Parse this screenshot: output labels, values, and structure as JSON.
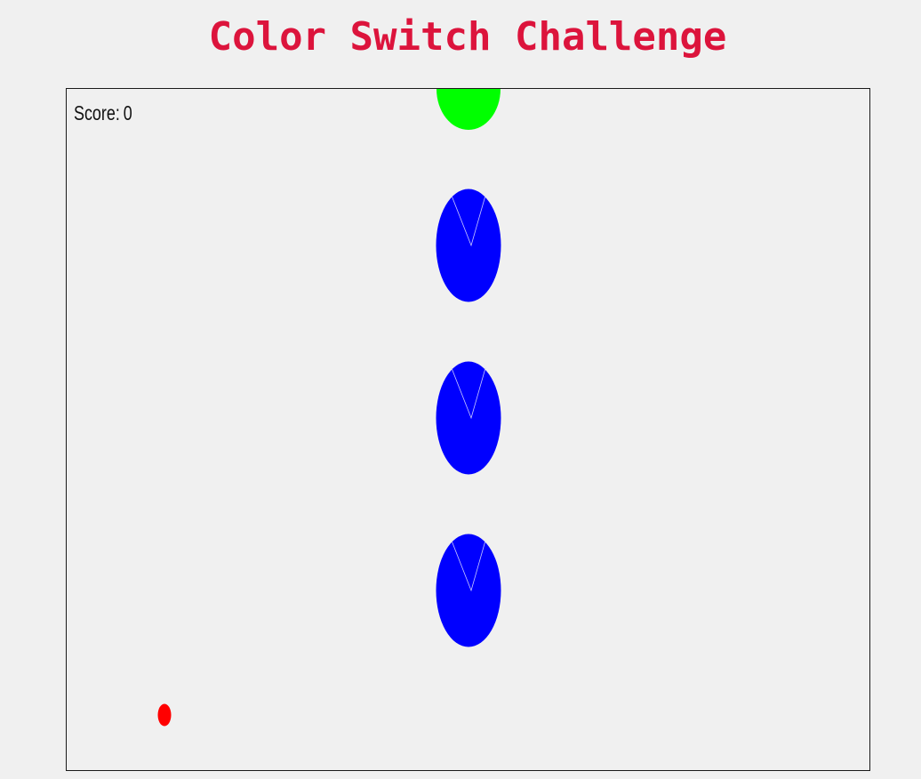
{
  "header": {
    "title": "Color Switch Challenge"
  },
  "hud": {
    "score_label": "Score:",
    "score_value": "0"
  },
  "colors": {
    "title": "#dc143c",
    "background": "#f0f0f0",
    "obstacle": "#0000ff",
    "color_switcher": "#00ff00",
    "player_ball": "#ff0000"
  }
}
